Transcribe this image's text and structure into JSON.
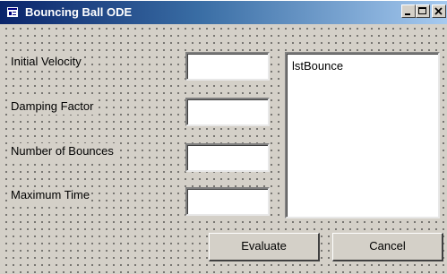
{
  "window": {
    "title": "Bouncing Ball ODE",
    "controls": {
      "minimize": "minimize-icon",
      "maximize": "maximize-icon",
      "close": "close-icon"
    }
  },
  "form": {
    "fields": [
      {
        "label": "Initial Velocity",
        "value": ""
      },
      {
        "label": "Damping Factor",
        "value": ""
      },
      {
        "label": "Number of Bounces",
        "value": ""
      },
      {
        "label": "Maximum Time",
        "value": ""
      }
    ],
    "list": {
      "name": "lstBounce"
    },
    "buttons": {
      "evaluate": "Evaluate",
      "cancel": "Cancel"
    }
  },
  "colors": {
    "title_gradient_start": "#0a246a",
    "title_gradient_end": "#a6caf0",
    "face": "#d4d0c8"
  }
}
